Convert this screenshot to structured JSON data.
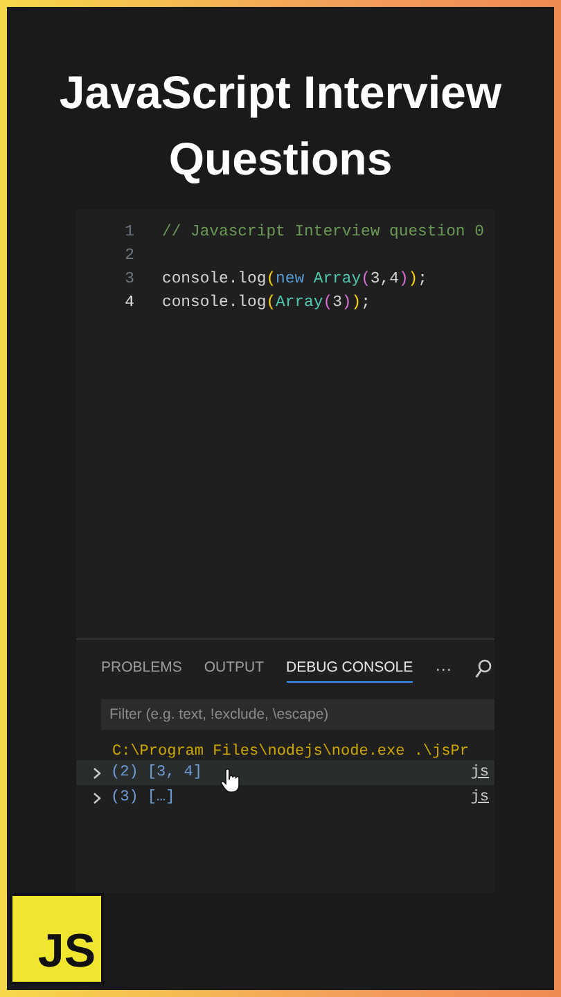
{
  "headline": "JavaScript Interview Questions",
  "editor": {
    "lines": [
      {
        "number": "1",
        "active": false,
        "tokens": [
          {
            "kind": "comment",
            "text": "// Javascript Interview question 0"
          }
        ]
      },
      {
        "number": "2",
        "active": false
      },
      {
        "number": "3",
        "active": false,
        "tokens": [
          {
            "kind": "plain",
            "text": "console.log"
          },
          {
            "kind": "paren",
            "text": "("
          },
          {
            "kind": "keyword",
            "text": "new "
          },
          {
            "kind": "class",
            "text": "Array"
          },
          {
            "kind": "paren2",
            "text": "("
          },
          {
            "kind": "plain",
            "text": "3,4"
          },
          {
            "kind": "paren2",
            "text": ")"
          },
          {
            "kind": "paren",
            "text": ")"
          },
          {
            "kind": "plain",
            "text": ";"
          }
        ]
      },
      {
        "number": "4",
        "active": true,
        "tokens": [
          {
            "kind": "plain",
            "text": "console.log"
          },
          {
            "kind": "paren",
            "text": "("
          },
          {
            "kind": "class",
            "text": "Array"
          },
          {
            "kind": "paren2",
            "text": "("
          },
          {
            "kind": "plain",
            "text": "3"
          },
          {
            "kind": "paren2",
            "text": ")"
          },
          {
            "kind": "paren",
            "text": ")"
          },
          {
            "kind": "plain",
            "text": ";"
          }
        ]
      }
    ]
  },
  "panel": {
    "tabs": [
      {
        "label": "PROBLEMS",
        "selected": false
      },
      {
        "label": "OUTPUT",
        "selected": false
      },
      {
        "label": "DEBUG CONSOLE",
        "selected": true
      }
    ],
    "more": "···",
    "filter": {
      "placeholder": "Filter (e.g. text, !exclude, \\escape)"
    },
    "command": "C:\\Program Files\\nodejs\\node.exe .\\jsPr",
    "entries": [
      {
        "value": "(2) [3, 4]",
        "source": "js",
        "highlighted": true
      },
      {
        "value": "(3) […]",
        "source": "js",
        "highlighted": false
      }
    ]
  },
  "logo": "JS"
}
